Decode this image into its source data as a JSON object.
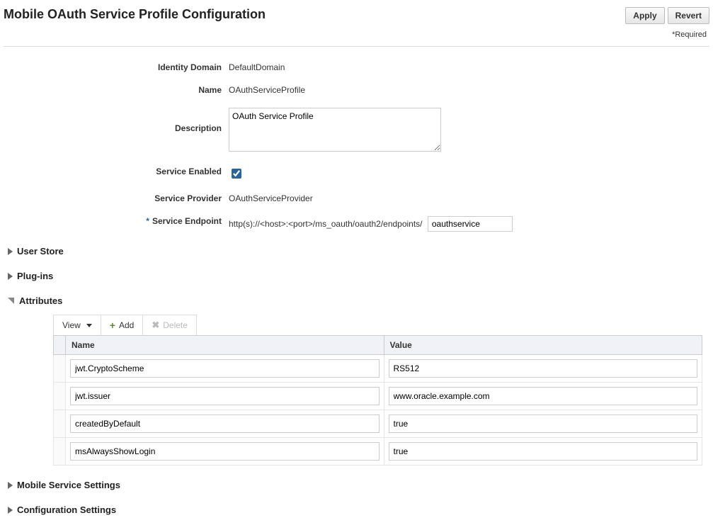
{
  "page": {
    "title": "Mobile OAuth Service Profile Configuration",
    "required_note": "*Required"
  },
  "actions": {
    "apply": "Apply",
    "revert": "Revert"
  },
  "form": {
    "identity_domain": {
      "label": "Identity Domain",
      "value": "DefaultDomain"
    },
    "name": {
      "label": "Name",
      "value": "OAuthServiceProfile"
    },
    "description": {
      "label": "Description",
      "value": "OAuth Service Profile"
    },
    "service_enabled": {
      "label": "Service Enabled",
      "checked": true
    },
    "service_provider": {
      "label": "Service Provider",
      "value": "OAuthServiceProvider"
    },
    "service_endpoint": {
      "label": "Service Endpoint",
      "prefix": "http(s)://<host>:<port>/ms_oauth/oauth2/endpoints/",
      "value": "oauthservice"
    }
  },
  "sections": {
    "user_store": "User Store",
    "plugins": "Plug-ins",
    "attributes": "Attributes",
    "mobile_service_settings": "Mobile Service Settings",
    "configuration_settings": "Configuration Settings"
  },
  "attributes": {
    "toolbar": {
      "view": "View",
      "add": "Add",
      "delete": "Delete"
    },
    "columns": {
      "name": "Name",
      "value": "Value"
    },
    "rows": [
      {
        "name": "jwt.CryptoScheme",
        "value": "RS512"
      },
      {
        "name": "jwt.issuer",
        "value": "www.oracle.example.com"
      },
      {
        "name": "createdByDefault",
        "value": "true"
      },
      {
        "name": "msAlwaysShowLogin",
        "value": "true"
      }
    ]
  }
}
